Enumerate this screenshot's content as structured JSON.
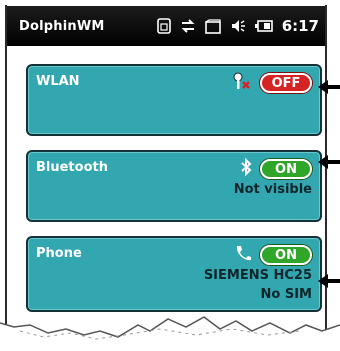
{
  "statusbar": {
    "title": "DolphinWM",
    "icons": [
      "sim-card-icon",
      "sync-arrows-icon",
      "window-icon",
      "volume-icon",
      "battery-icon"
    ],
    "time": "6:17"
  },
  "panels": [
    {
      "label": "WLAN",
      "status": "OFF",
      "status_color": "#d62424",
      "icon": "wlan-key-disabled-icon",
      "details": []
    },
    {
      "label": "Bluetooth",
      "status": "ON",
      "status_color": "#2fa52a",
      "icon": "bluetooth-icon",
      "details": [
        "Not visible"
      ]
    },
    {
      "label": "Phone",
      "status": "ON",
      "status_color": "#2fa52a",
      "icon": "phone-icon",
      "details": [
        "SIEMENS HC25",
        "No SIM"
      ]
    }
  ],
  "colors": {
    "panel": "#33a7b0",
    "panel_border": "#14323a",
    "statusbar": "#000000"
  }
}
